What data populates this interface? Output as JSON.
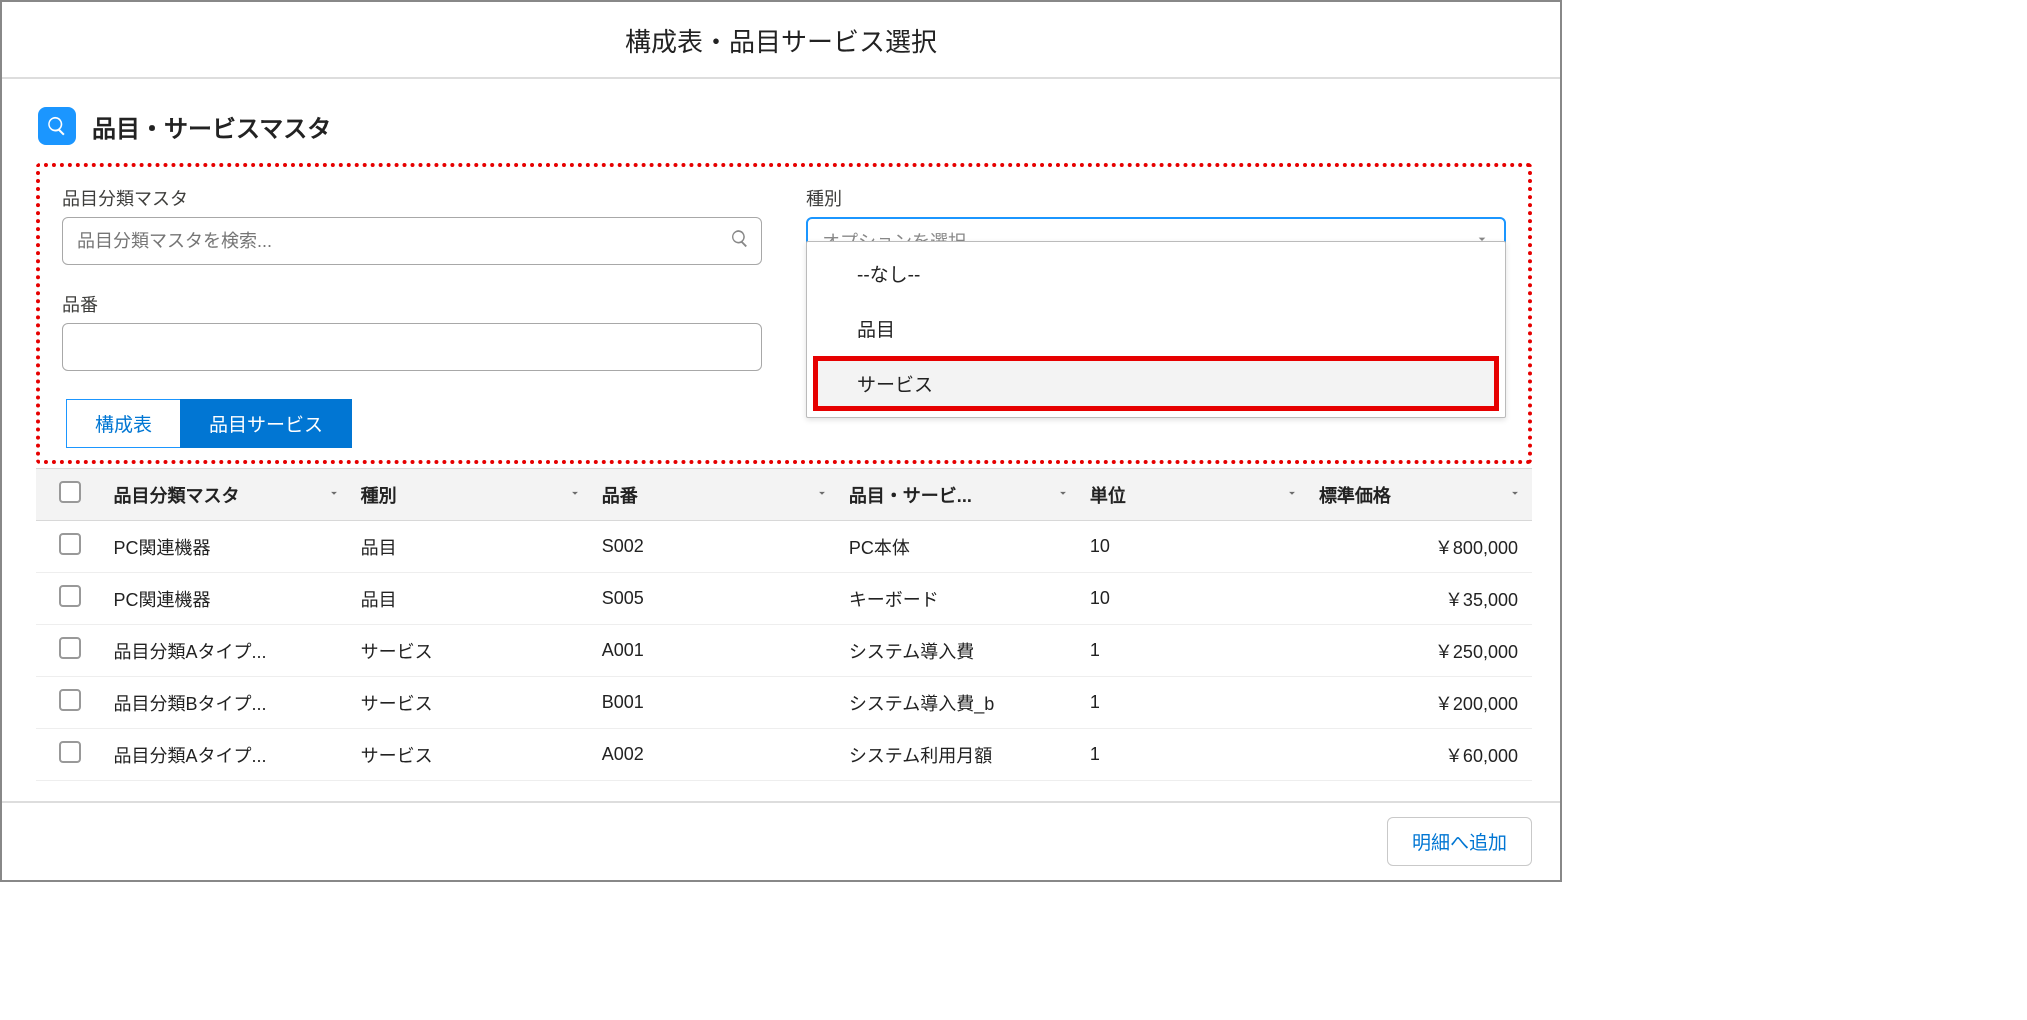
{
  "title": "構成表・品目サービス選択",
  "section_title": "品目・サービスマスタ",
  "filters": {
    "category": {
      "label": "品目分類マスタ",
      "placeholder": "品目分類マスタを検索..."
    },
    "type": {
      "label": "種別",
      "placeholder": "オプションを選択",
      "options": [
        "--なし--",
        "品目",
        "サービス"
      ],
      "highlighted_option": "サービス"
    },
    "part_no": {
      "label": "品番",
      "value": ""
    }
  },
  "tabs": [
    {
      "label": "構成表",
      "active": false
    },
    {
      "label": "品目サービス",
      "active": true
    }
  ],
  "columns": [
    "品目分類マスタ",
    "種別",
    "品番",
    "品目・サービ...",
    "単位",
    "標準価格"
  ],
  "rows": [
    {
      "category": "PC関連機器",
      "type": "品目",
      "part_no": "S002",
      "name": "PC本体",
      "unit": "10",
      "price": "￥800,000"
    },
    {
      "category": "PC関連機器",
      "type": "品目",
      "part_no": "S005",
      "name": "キーボード",
      "unit": "10",
      "price": "￥35,000"
    },
    {
      "category": "品目分類Aタイプ...",
      "type": "サービス",
      "part_no": "A001",
      "name": "システム導入費",
      "unit": "1",
      "price": "￥250,000"
    },
    {
      "category": "品目分類Bタイプ...",
      "type": "サービス",
      "part_no": "B001",
      "name": "システム導入費_b",
      "unit": "1",
      "price": "￥200,000"
    },
    {
      "category": "品目分類Aタイプ...",
      "type": "サービス",
      "part_no": "A002",
      "name": "システム利用月額",
      "unit": "1",
      "price": "￥60,000"
    }
  ],
  "footer_button": "明細へ追加"
}
